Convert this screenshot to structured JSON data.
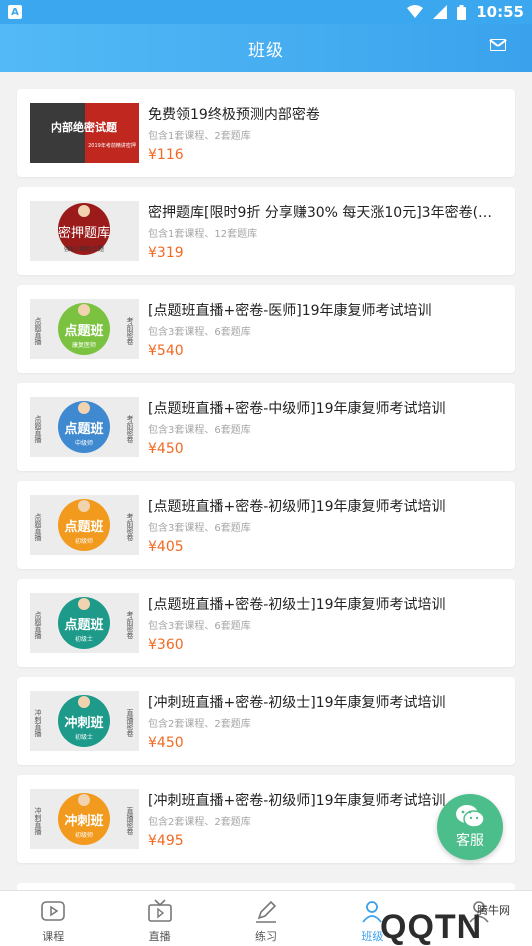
{
  "status_bar": {
    "time": "10:55",
    "app_icon": "A"
  },
  "header": {
    "title": "班级",
    "mail_icon": "mail-icon"
  },
  "courses": [
    {
      "thumb_text": "内部绝密试题",
      "thumb_sub": "2019年考前精讲密押",
      "title": "免费领19终极预测内部密卷",
      "sub": "包含1套课程、2套题库",
      "price": "¥116"
    },
    {
      "thumb_text": "密押题库",
      "thumb_sub": "强化/冲刺/点题",
      "title": "密押题库[限时9折 分享赚30% 每天涨10元]3年密卷(含…",
      "sub": "包含1套课程、12套题库",
      "price": "¥319"
    },
    {
      "thumb_text": "点题班",
      "thumb_sub": "康复医师",
      "thumb_left": "点题直播",
      "thumb_right": "考前密卷",
      "title": "[点题班直播+密卷-医师]19年康复师考试培训",
      "sub": "包含3套课程、6套题库",
      "price": "¥540"
    },
    {
      "thumb_text": "点题班",
      "thumb_sub": "中级师",
      "thumb_left": "点题直播",
      "thumb_right": "考前密卷",
      "title": "[点题班直播+密卷-中级师]19年康复师考试培训",
      "sub": "包含3套课程、6套题库",
      "price": "¥450"
    },
    {
      "thumb_text": "点题班",
      "thumb_sub": "初级师",
      "thumb_left": "点题直播",
      "thumb_right": "考前密卷",
      "title": "[点题班直播+密卷-初级师]19年康复师考试培训",
      "sub": "包含3套课程、6套题库",
      "price": "¥405"
    },
    {
      "thumb_text": "点题班",
      "thumb_sub": "初级士",
      "thumb_left": "点题直播",
      "thumb_right": "考前密卷",
      "title": "[点题班直播+密卷-初级士]19年康复师考试培训",
      "sub": "包含3套课程、6套题库",
      "price": "¥360"
    },
    {
      "thumb_text": "冲刺班",
      "thumb_sub": "初级士",
      "thumb_left": "冲刺直播",
      "thumb_right": "直播密卷",
      "title": "[冲刺班直播+密卷-初级士]19年康复师考试培训",
      "sub": "包含2套课程、2套题库",
      "price": "¥450"
    },
    {
      "thumb_text": "冲刺班",
      "thumb_sub": "初级师",
      "thumb_left": "冲刺直播",
      "thumb_right": "直播密卷",
      "title": "[冲刺班直播+密卷-初级师]19年康复师考试培训",
      "sub": "包含2套课程、2套题库",
      "price": "¥495"
    }
  ],
  "service_button": {
    "label": "客服"
  },
  "tabs": [
    {
      "label": "课程",
      "icon": "play-icon"
    },
    {
      "label": "直播",
      "icon": "tv-icon"
    },
    {
      "label": "练习",
      "icon": "pen-icon"
    },
    {
      "label": "班级",
      "icon": "class-icon"
    },
    {
      "label": "",
      "icon": "profile-icon"
    }
  ],
  "watermark": {
    "text": "QQTN",
    "sub": "腾牛网"
  },
  "colors": {
    "header": "#3aa2ec",
    "price": "#f06a22",
    "service": "#4cbe8b",
    "badge_green": "#7cc241",
    "badge_blue": "#3f89d0",
    "badge_orange": "#f29a1d",
    "badge_teal": "#1d9a8a"
  }
}
